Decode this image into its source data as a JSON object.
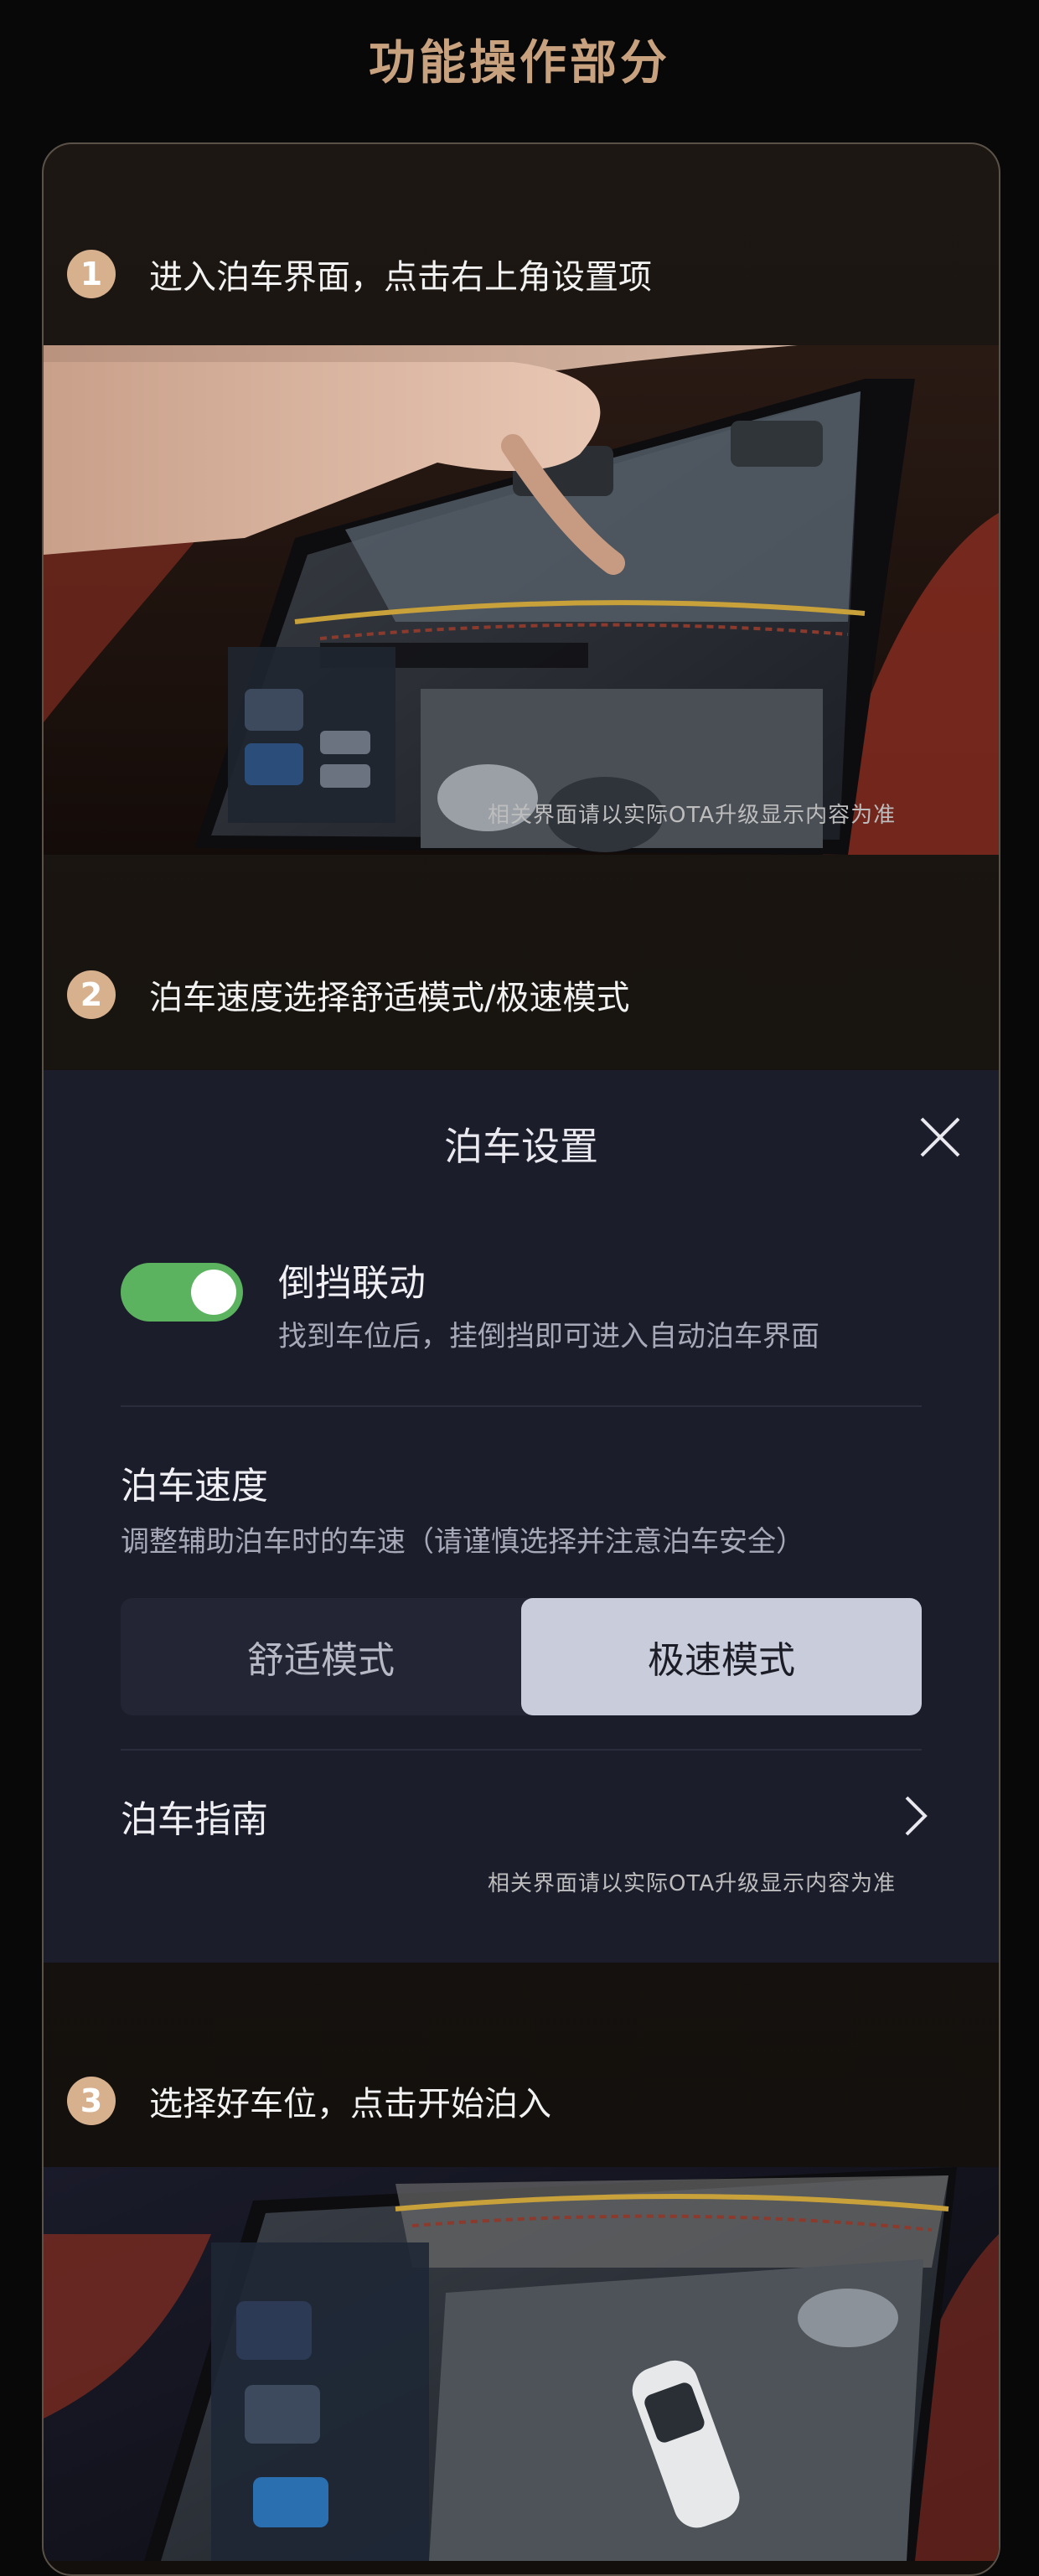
{
  "page": {
    "title": "功能操作部分"
  },
  "steps": [
    {
      "num": "1",
      "text": "进入泊车界面，点击右上角设置项"
    },
    {
      "num": "2",
      "text": "泊车速度选择舒适模式/极速模式"
    },
    {
      "num": "3",
      "text": "选择好车位，点击开始泊入"
    }
  ],
  "photo1": {
    "note": "相关界面请以实际OTA升级显示内容为准"
  },
  "settings": {
    "title": "泊车设置",
    "close_icon": "close-icon",
    "reverse_link": {
      "label": "倒挡联动",
      "description": "找到车位后，挂倒挡即可进入自动泊车界面",
      "enabled": true
    },
    "speed": {
      "label": "泊车速度",
      "description": "调整辅助泊车时的车速（请谨慎选择并注意泊车安全）",
      "options": [
        "舒适模式",
        "极速模式"
      ],
      "selected": "极速模式"
    },
    "guide": {
      "label": "泊车指南",
      "icon": "chevron-right-icon"
    },
    "note": "相关界面请以实际OTA升级显示内容为准"
  },
  "colors": {
    "accent": "#c8a17f",
    "toggle_on": "#5bb25f",
    "panel_bg": "#1c1d2b"
  }
}
